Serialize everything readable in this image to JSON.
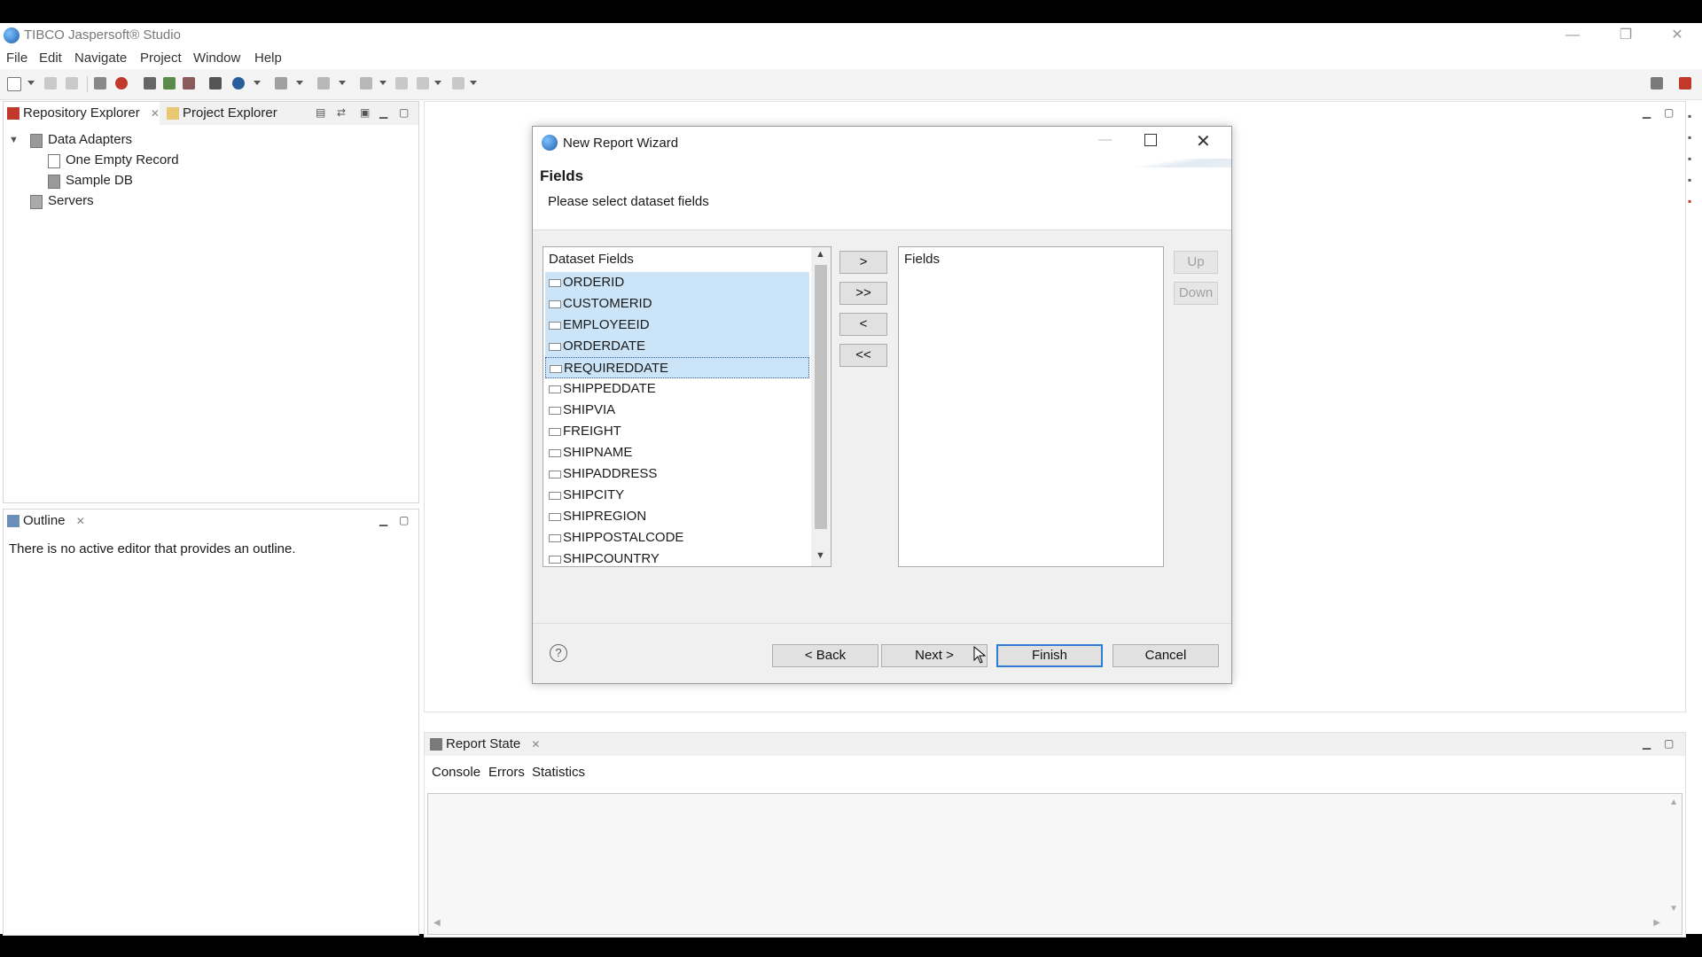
{
  "window": {
    "title": "TIBCO Jaspersoft® Studio"
  },
  "menu": [
    "File",
    "Edit",
    "Navigate",
    "Project",
    "Window",
    "Help"
  ],
  "repository_pane": {
    "tabs": [
      "Repository Explorer",
      "Project Explorer"
    ],
    "tree": {
      "data_adapters": "Data Adapters",
      "children": [
        "One Empty Record",
        "Sample DB"
      ],
      "servers": "Servers"
    }
  },
  "outline_pane": {
    "tab": "Outline",
    "message": "There is no active editor that provides an outline."
  },
  "dialog": {
    "title": "New Report Wizard",
    "heading": "Fields",
    "description": "Please select dataset fields",
    "dataset_header": "Dataset Fields",
    "fields_header": "Fields",
    "dataset_fields": [
      {
        "name": "ORDERID",
        "selected": true
      },
      {
        "name": "CUSTOMERID",
        "selected": true
      },
      {
        "name": "EMPLOYEEID",
        "selected": true
      },
      {
        "name": "ORDERDATE",
        "selected": true
      },
      {
        "name": "REQUIREDDATE",
        "selected": true
      },
      {
        "name": "SHIPPEDDATE",
        "selected": false
      },
      {
        "name": "SHIPVIA",
        "selected": false
      },
      {
        "name": "FREIGHT",
        "selected": false
      },
      {
        "name": "SHIPNAME",
        "selected": false
      },
      {
        "name": "SHIPADDRESS",
        "selected": false
      },
      {
        "name": "SHIPCITY",
        "selected": false
      },
      {
        "name": "SHIPREGION",
        "selected": false
      },
      {
        "name": "SHIPPOSTALCODE",
        "selected": false
      },
      {
        "name": "SHIPCOUNTRY",
        "selected": false
      }
    ],
    "transfer_buttons": {
      "add": ">",
      "add_all": ">>",
      "remove": "<",
      "remove_all": "<<"
    },
    "order_buttons": {
      "up": "Up",
      "down": "Down"
    },
    "nav_buttons": {
      "back": "< Back",
      "next": "Next >",
      "finish": "Finish",
      "cancel": "Cancel"
    },
    "help_icon": "?"
  },
  "report_state": {
    "tab": "Report State",
    "subtabs": [
      "Console",
      "Errors",
      "Statistics"
    ]
  },
  "colors": {
    "selection": "#cce4f7",
    "accent": "#2f7bd6"
  }
}
